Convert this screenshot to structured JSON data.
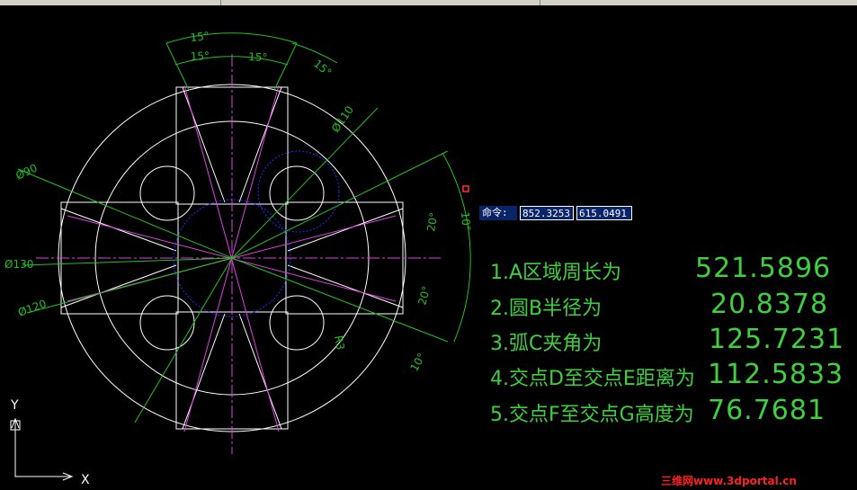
{
  "command": {
    "label": "命令:",
    "x": "852.3253",
    "y": "615.0491"
  },
  "results": [
    {
      "label": "1.A区域周长为",
      "value": "521.5896"
    },
    {
      "label": "2.圆B半径为",
      "value": "20.8378"
    },
    {
      "label": "3.弧C夹角为",
      "value": "125.7231"
    },
    {
      "label": "4.交点D至交点E距离为",
      "value": "112.5833"
    },
    {
      "label": "5.交点F至交点G高度为",
      "value": "76.7681"
    }
  ],
  "dimensions": {
    "ang_15_a": "15°",
    "ang_15_b": "15°",
    "ang_15_c": "15°",
    "ang_15_d": "15°",
    "dia_110": "Ø110",
    "dia_90": "Ø90",
    "dia_130": "Ø130",
    "dia_120": "Ø120",
    "ang_20_a": "20°",
    "ang_20_b": "20°",
    "ang_10_a": "10°",
    "ang_10_b": "10°",
    "rad_3": "R3"
  },
  "ucs": {
    "x_label": "X",
    "y_label": "Y"
  },
  "watermark": "三维网www.3dportal.cn",
  "colors": {
    "background": "#000000",
    "geometry": "#ffffff",
    "centerline": "#e040e0",
    "dimension": "#22c022",
    "hidden": "#2030ff",
    "text": "#3fcf3f",
    "watermark": "#ff2020"
  }
}
